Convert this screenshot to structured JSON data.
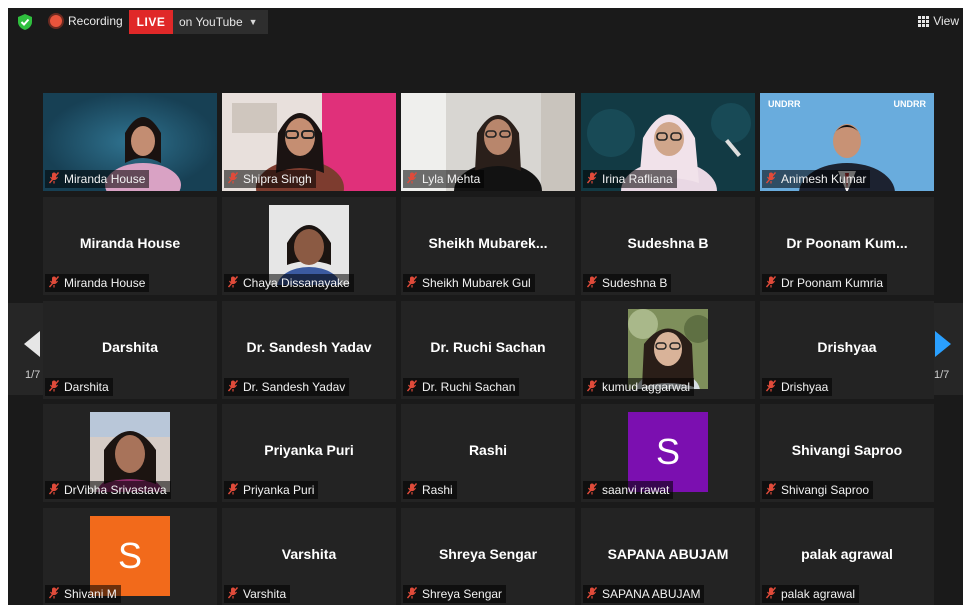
{
  "topbar": {
    "recording_label": "Recording",
    "live_badge": "LIVE",
    "stream_target": "on YouTube",
    "view_label": "View",
    "shield_color": "#2fbf3e",
    "live_color": "#e02828"
  },
  "pagination": {
    "left_page": "1/7",
    "right_page": "1/7"
  },
  "participants": [
    {
      "display_name": "",
      "nameplate": "Miranda House",
      "kind": "video",
      "video_style": "miranda"
    },
    {
      "display_name": "",
      "nameplate": "Shipra Singh",
      "kind": "video",
      "video_style": "shipra"
    },
    {
      "display_name": "",
      "nameplate": "Lyla Mehta",
      "kind": "video",
      "video_style": "lyla"
    },
    {
      "display_name": "",
      "nameplate": "Irina Rafliana",
      "kind": "video",
      "video_style": "irina"
    },
    {
      "display_name": "",
      "nameplate": "Animesh Kumar",
      "kind": "video",
      "video_style": "animesh",
      "active": true,
      "logo_text": "UNDRR"
    },
    {
      "display_name": "Miranda House",
      "nameplate": "Miranda House",
      "kind": "name"
    },
    {
      "display_name": "",
      "nameplate": "Chaya Dissanayake",
      "kind": "photo",
      "photo_style": "chaya"
    },
    {
      "display_name": "Sheikh Mubarek...",
      "nameplate": "Sheikh Mubarek Gul",
      "kind": "name"
    },
    {
      "display_name": "Sudeshna B",
      "nameplate": "Sudeshna B",
      "kind": "name"
    },
    {
      "display_name": "Dr Poonam Kum...",
      "nameplate": "Dr Poonam Kumria",
      "kind": "name"
    },
    {
      "display_name": "Darshita",
      "nameplate": "Darshita",
      "kind": "name"
    },
    {
      "display_name": "Dr. Sandesh Yadav",
      "nameplate": "Dr. Sandesh Yadav",
      "kind": "name"
    },
    {
      "display_name": "Dr. Ruchi Sachan",
      "nameplate": "Dr. Ruchi Sachan",
      "kind": "name"
    },
    {
      "display_name": "",
      "nameplate": "kumud aggarwal",
      "kind": "photo",
      "photo_style": "kumud"
    },
    {
      "display_name": "Drishyaa",
      "nameplate": "Drishyaa",
      "kind": "name"
    },
    {
      "display_name": "",
      "nameplate": "DrVibha Srivastava",
      "kind": "photo",
      "photo_style": "vibha"
    },
    {
      "display_name": "Priyanka Puri",
      "nameplate": "Priyanka Puri",
      "kind": "name"
    },
    {
      "display_name": "Rashi",
      "nameplate": "Rashi",
      "kind": "name"
    },
    {
      "display_name": "",
      "nameplate": "saanvi rawat",
      "kind": "avatar",
      "initial": "S",
      "color": "#7b0fb0"
    },
    {
      "display_name": "Shivangi Saproo",
      "nameplate": "Shivangi Saproo",
      "kind": "name"
    },
    {
      "display_name": "",
      "nameplate": "Shivani M",
      "kind": "avatar",
      "initial": "S",
      "color": "#f26a1b"
    },
    {
      "display_name": "Varshita",
      "nameplate": "Varshita",
      "kind": "name"
    },
    {
      "display_name": "Shreya Sengar",
      "nameplate": "Shreya Sengar",
      "kind": "name"
    },
    {
      "display_name": "SAPANA ABUJAM",
      "nameplate": "SAPANA ABUJAM",
      "kind": "name"
    },
    {
      "display_name": "palak agrawal",
      "nameplate": "palak agrawal",
      "kind": "name"
    }
  ],
  "icons": {
    "mic_muted": "mic-muted-icon",
    "shield": "shield-icon",
    "view_grid": "grid-view-icon"
  },
  "colors": {
    "tile_bg": "#232323",
    "active_border": "#b5e64d",
    "muted_mic": "#e04b3a",
    "next_arrow": "#2aa0ff"
  }
}
